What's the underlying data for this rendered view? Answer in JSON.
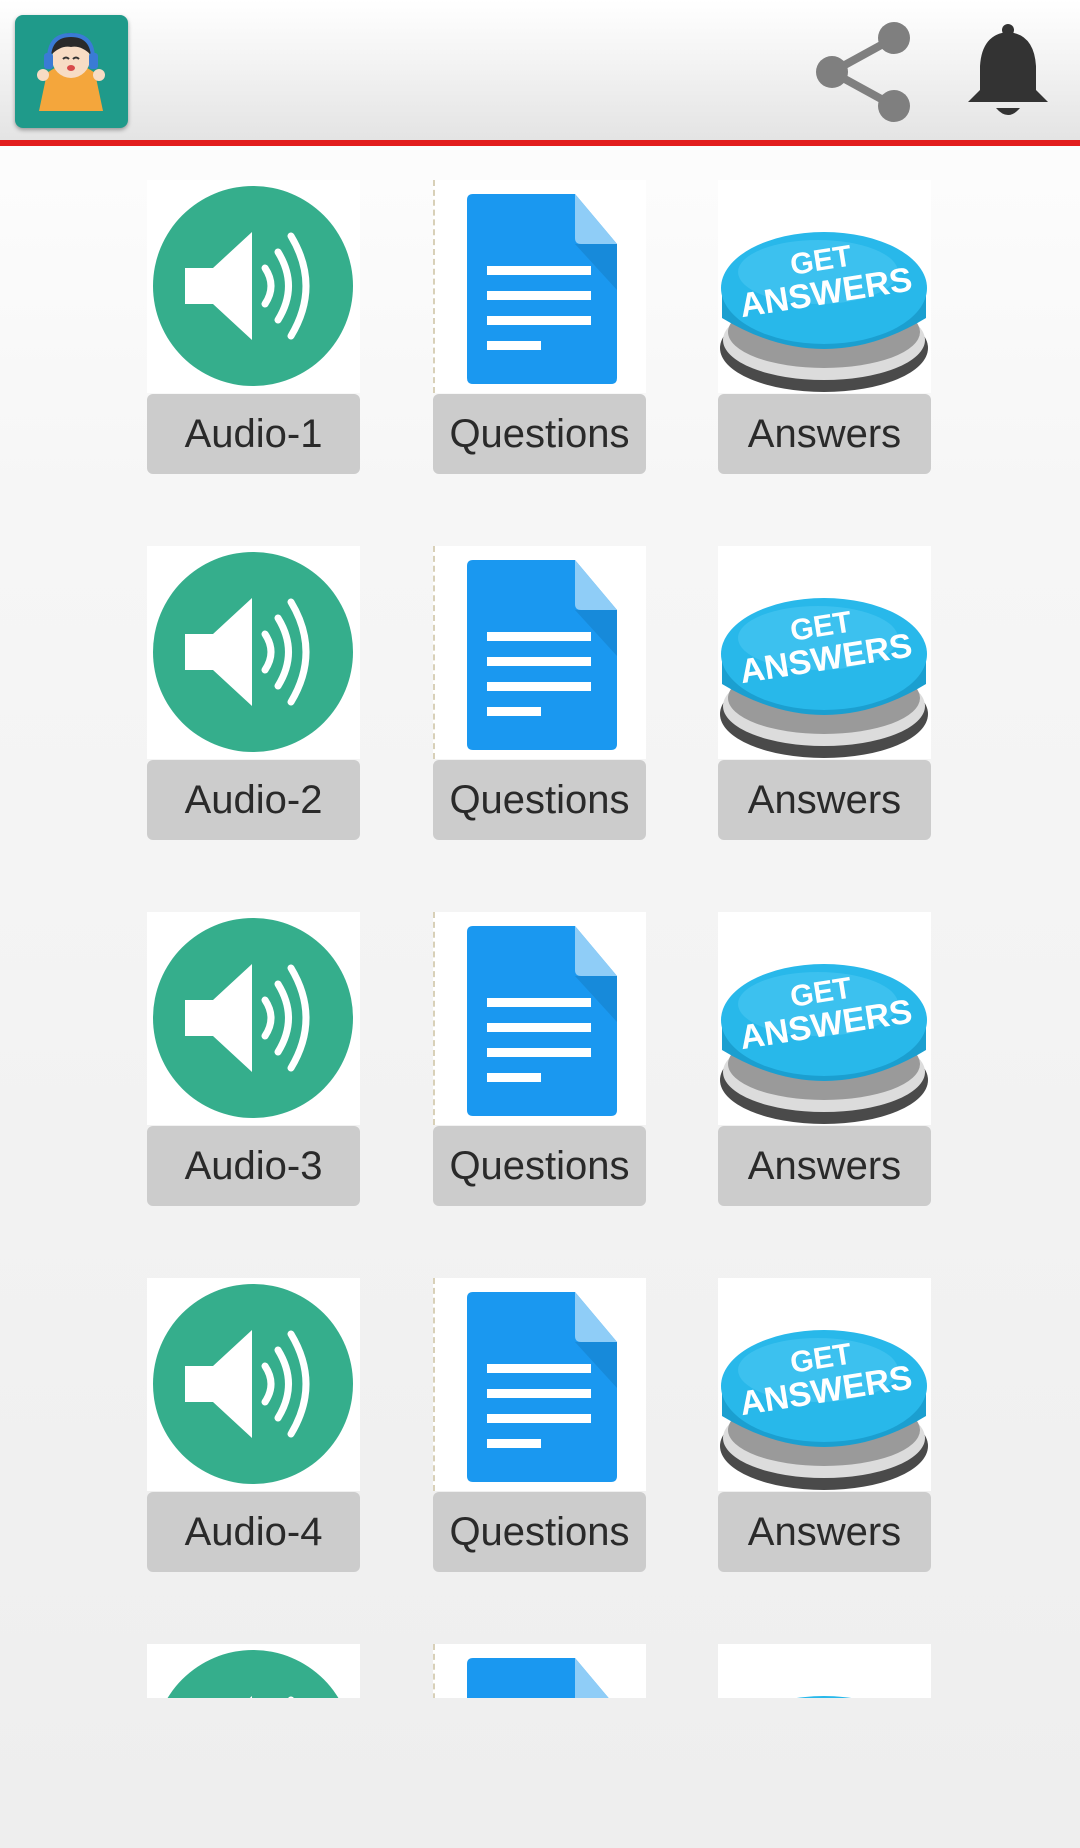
{
  "toolbar": {
    "app_icon": "kid-with-headphones-icon",
    "actions": [
      "share-icon",
      "bell-icon"
    ],
    "accent_color": "#e21d1d"
  },
  "grid": {
    "rows": [
      {
        "audio": "Audio-1",
        "questions": "Questions",
        "answers": "Answers"
      },
      {
        "audio": "Audio-2",
        "questions": "Questions",
        "answers": "Answers"
      },
      {
        "audio": "Audio-3",
        "questions": "Questions",
        "answers": "Answers"
      },
      {
        "audio": "Audio-4",
        "questions": "Questions",
        "answers": "Answers"
      }
    ],
    "answers_button_text": [
      "GET",
      "ANSWERS"
    ],
    "colors": {
      "audio": "#35ae8c",
      "document": "#1a98f0",
      "answers": "#22b4e6"
    }
  }
}
